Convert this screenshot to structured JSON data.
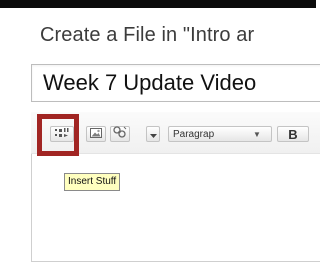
{
  "dialog": {
    "title": "Create a File in \"Intro ar"
  },
  "title_field": {
    "value": "Week 7 Update Video"
  },
  "toolbar": {
    "insert_icon": "insert-stuff-icon",
    "image_icon": "image-icon",
    "link_icon": "link-icon",
    "dropdown_icon": "chevron-down-icon",
    "format_select": "Paragrap",
    "bold_label": "B"
  },
  "tooltip": {
    "text": "Insert Stuff"
  },
  "colors": {
    "highlight": "#a12523",
    "tooltip_bg": "#ffffbf"
  }
}
